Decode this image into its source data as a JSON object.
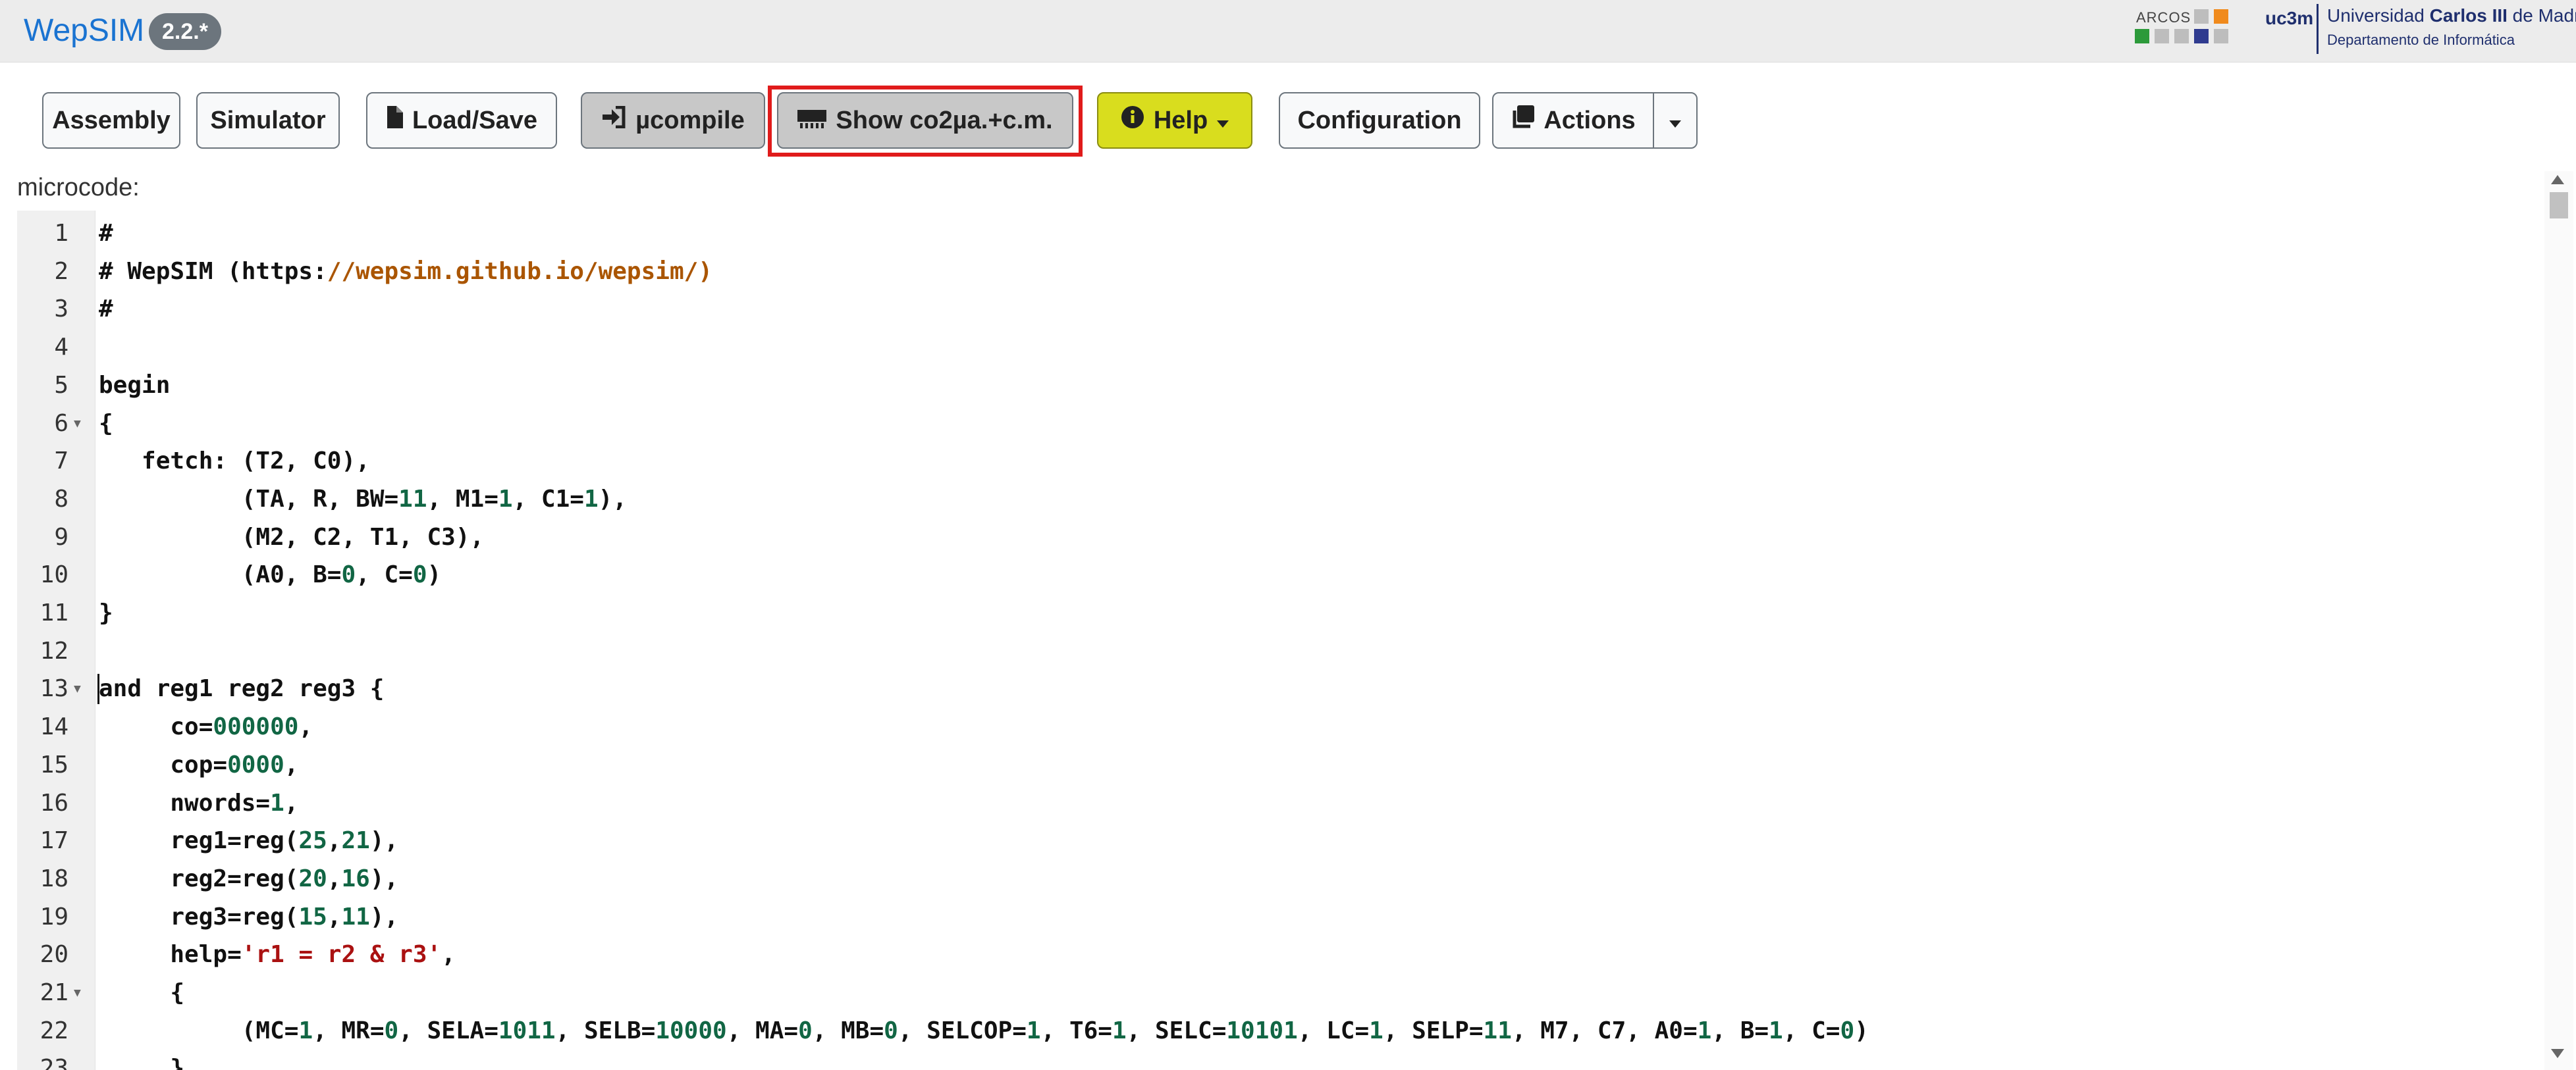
{
  "navbar": {
    "brand": "WepSIM",
    "version": "2.2.*",
    "arcos_label": "ARCOS",
    "uc3m_label": "uc3m",
    "university_prefix": "Universidad ",
    "university_bold": "Carlos III",
    "university_suffix": " de Madrid",
    "department": "Departamento de Informática"
  },
  "toolbar": {
    "assembly": "Assembly",
    "simulator": "Simulator",
    "loadsave": "Load/Save",
    "ucompile": "µcompile",
    "show": "Show co2µa.+c.m.",
    "help": "Help",
    "configuration": "Configuration",
    "actions": "Actions"
  },
  "editor": {
    "label": "microcode:",
    "lines": [
      {
        "n": "1",
        "fold": false,
        "code": [
          {
            "t": "#"
          }
        ]
      },
      {
        "n": "2",
        "fold": false,
        "code": [
          {
            "t": "# WepSIM (https:"
          },
          {
            "t": "//wepsim.github.io/wepsim/)",
            "c": "url"
          }
        ]
      },
      {
        "n": "3",
        "fold": false,
        "code": [
          {
            "t": "#"
          }
        ]
      },
      {
        "n": "4",
        "fold": false,
        "code": []
      },
      {
        "n": "5",
        "fold": false,
        "code": [
          {
            "t": "begin"
          }
        ]
      },
      {
        "n": "6",
        "fold": true,
        "code": [
          {
            "t": "{"
          }
        ]
      },
      {
        "n": "7",
        "fold": false,
        "code": [
          {
            "t": "   fetch: (T2, C0),"
          }
        ]
      },
      {
        "n": "8",
        "fold": false,
        "code": [
          {
            "t": "          (TA, R, BW="
          },
          {
            "t": "11",
            "c": "num"
          },
          {
            "t": ", M1="
          },
          {
            "t": "1",
            "c": "num"
          },
          {
            "t": ", C1="
          },
          {
            "t": "1",
            "c": "num"
          },
          {
            "t": "),"
          }
        ]
      },
      {
        "n": "9",
        "fold": false,
        "code": [
          {
            "t": "          (M2, C2, T1, C3),"
          }
        ]
      },
      {
        "n": "10",
        "fold": false,
        "code": [
          {
            "t": "          (A0, B="
          },
          {
            "t": "0",
            "c": "num"
          },
          {
            "t": ", C="
          },
          {
            "t": "0",
            "c": "num"
          },
          {
            "t": ")"
          }
        ]
      },
      {
        "n": "11",
        "fold": false,
        "code": [
          {
            "t": "}"
          }
        ]
      },
      {
        "n": "12",
        "fold": false,
        "code": []
      },
      {
        "n": "13",
        "fold": true,
        "cursor": true,
        "code": [
          {
            "t": "and reg1 reg2 reg3 {"
          }
        ]
      },
      {
        "n": "14",
        "fold": false,
        "code": [
          {
            "t": "     co="
          },
          {
            "t": "000000",
            "c": "num"
          },
          {
            "t": ","
          }
        ]
      },
      {
        "n": "15",
        "fold": false,
        "code": [
          {
            "t": "     cop="
          },
          {
            "t": "0000",
            "c": "num"
          },
          {
            "t": ","
          }
        ]
      },
      {
        "n": "16",
        "fold": false,
        "code": [
          {
            "t": "     nwords="
          },
          {
            "t": "1",
            "c": "num"
          },
          {
            "t": ","
          }
        ]
      },
      {
        "n": "17",
        "fold": false,
        "code": [
          {
            "t": "     reg1=reg("
          },
          {
            "t": "25",
            "c": "num"
          },
          {
            "t": ","
          },
          {
            "t": "21",
            "c": "num"
          },
          {
            "t": "),"
          }
        ]
      },
      {
        "n": "18",
        "fold": false,
        "code": [
          {
            "t": "     reg2=reg("
          },
          {
            "t": "20",
            "c": "num"
          },
          {
            "t": ","
          },
          {
            "t": "16",
            "c": "num"
          },
          {
            "t": "),"
          }
        ]
      },
      {
        "n": "19",
        "fold": false,
        "code": [
          {
            "t": "     reg3=reg("
          },
          {
            "t": "15",
            "c": "num"
          },
          {
            "t": ","
          },
          {
            "t": "11",
            "c": "num"
          },
          {
            "t": "),"
          }
        ]
      },
      {
        "n": "20",
        "fold": false,
        "code": [
          {
            "t": "     help="
          },
          {
            "t": "'r1 = r2 & r3'",
            "c": "str"
          },
          {
            "t": ","
          }
        ]
      },
      {
        "n": "21",
        "fold": true,
        "code": [
          {
            "t": "     {"
          }
        ]
      },
      {
        "n": "22",
        "fold": false,
        "code": [
          {
            "t": "          (MC="
          },
          {
            "t": "1",
            "c": "num"
          },
          {
            "t": ", MR="
          },
          {
            "t": "0",
            "c": "num"
          },
          {
            "t": ", SELA="
          },
          {
            "t": "1011",
            "c": "num"
          },
          {
            "t": ", SELB="
          },
          {
            "t": "10000",
            "c": "num"
          },
          {
            "t": ", MA="
          },
          {
            "t": "0",
            "c": "num"
          },
          {
            "t": ", MB="
          },
          {
            "t": "0",
            "c": "num"
          },
          {
            "t": ", SELCOP="
          },
          {
            "t": "1",
            "c": "num"
          },
          {
            "t": ", T6="
          },
          {
            "t": "1",
            "c": "num"
          },
          {
            "t": ", SELC="
          },
          {
            "t": "10101",
            "c": "num"
          },
          {
            "t": ", LC="
          },
          {
            "t": "1",
            "c": "num"
          },
          {
            "t": ", SELP="
          },
          {
            "t": "11",
            "c": "num"
          },
          {
            "t": ", M7, C7, A0="
          },
          {
            "t": "1",
            "c": "num"
          },
          {
            "t": ", B="
          },
          {
            "t": "1",
            "c": "num"
          },
          {
            "t": ", C="
          },
          {
            "t": "0",
            "c": "num"
          },
          {
            "t": ")"
          }
        ]
      },
      {
        "n": "23",
        "fold": false,
        "code": [
          {
            "t": "     }"
          }
        ]
      }
    ]
  },
  "colors": {
    "brand": "#1a73d1",
    "help_button": "#d9dd1e",
    "highlight_outline": "#e01b1b",
    "number_token": "#116644",
    "string_token": "#aa1111",
    "url_token": "#aa5500"
  },
  "icons": {
    "loadsave": "file-icon",
    "ucompile": "sign-in-icon",
    "show": "memory-icon",
    "help": "info-circle-icon",
    "actions": "clone-icon",
    "actions_toggle": "caret-down-icon"
  }
}
